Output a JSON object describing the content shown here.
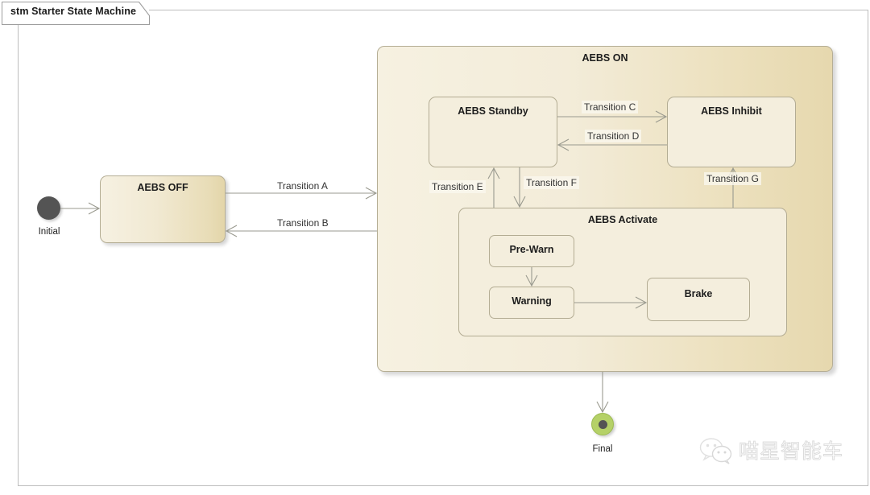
{
  "diagram": {
    "title": "stm Starter State Machine",
    "kind": "uml-state-machine"
  },
  "pseudostates": {
    "initial": {
      "label": "Initial",
      "color": "#545454"
    },
    "final": {
      "label": "Final",
      "color": "#b5d168",
      "inner_color": "#545454"
    }
  },
  "states": {
    "aebs_off": {
      "label": "AEBS OFF"
    },
    "aebs_on": {
      "label": "AEBS ON"
    },
    "aebs_standby": {
      "label": "AEBS Standby"
    },
    "aebs_inhibit": {
      "label": "AEBS Inhibit"
    },
    "aebs_activate": {
      "label": "AEBS Activate"
    },
    "pre_warn": {
      "label": "Pre-Warn"
    },
    "warning": {
      "label": "Warning"
    },
    "brake": {
      "label": "Brake"
    }
  },
  "transitions": [
    {
      "id": "a",
      "label": "Transition A",
      "from": "AEBS OFF",
      "to": "AEBS ON"
    },
    {
      "id": "b",
      "label": "Transition B",
      "from": "AEBS ON",
      "to": "AEBS OFF"
    },
    {
      "id": "c",
      "label": "Transition C",
      "from": "AEBS Standby",
      "to": "AEBS Inhibit"
    },
    {
      "id": "d",
      "label": "Transition D",
      "from": "AEBS Inhibit",
      "to": "AEBS Standby"
    },
    {
      "id": "e",
      "label": "Transition E",
      "from": "AEBS Activate",
      "to": "AEBS Standby"
    },
    {
      "id": "f",
      "label": "Transition F",
      "from": "AEBS Standby",
      "to": "AEBS Activate"
    },
    {
      "id": "g",
      "label": "Transition G",
      "from": "AEBS Activate",
      "to": "AEBS Inhibit"
    }
  ],
  "colors": {
    "region_fill_light": "#f6f1e1",
    "region_fill_dark": "#e6d8ae",
    "state_fill": "#f4eedd",
    "state_border": "#b3ac93",
    "connector": "#9a9a8f",
    "frame_border": "#bdbdbd"
  },
  "watermark": {
    "text": "喵星智能车",
    "icon": "wechat-icon"
  }
}
